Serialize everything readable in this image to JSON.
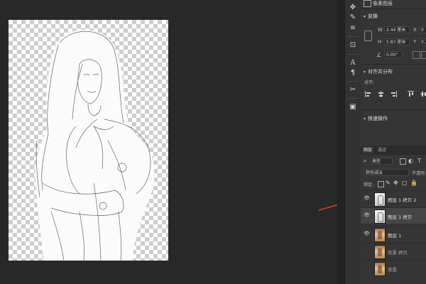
{
  "properties": {
    "layer_kind_label": "像素图层",
    "transform": {
      "title": "变换",
      "w_label": "W",
      "w_value": "2.44 厘米",
      "x_label": "X",
      "x_value": "0",
      "h_label": "H",
      "h_value": "5.83 厘米",
      "y_label": "Y",
      "y_value": "0.2",
      "angle_value": "0.00°"
    },
    "align": {
      "title": "对齐并分布",
      "subtitle": "对齐:"
    },
    "quick_actions": {
      "title": "快速操作"
    }
  },
  "layers_panel": {
    "tabs": [
      "图层",
      "通道"
    ],
    "filter_label": "类型",
    "blend_mode": "颜色减淡",
    "opacity_label": "不透明",
    "lock_label": "锁定:",
    "layers": [
      {
        "name": "图层 1 拷贝 2",
        "visible": true
      },
      {
        "name": "图层 1 拷贝",
        "visible": true
      },
      {
        "name": "图层 1",
        "visible": true
      },
      {
        "name": "背景 拷贝",
        "visible": false
      },
      {
        "name": "背景",
        "visible": false
      }
    ]
  },
  "colors": {
    "canvas_bg": "#282828",
    "panel_bg": "#353535",
    "selected_row": "#454545",
    "arrow": "#e03a2e"
  },
  "icons": [
    "move-icon",
    "brush-icon",
    "adjust-icon",
    "stamp-icon",
    "character-icon",
    "paragraph-icon",
    "tools-icon",
    "library-icon",
    "eye-icon",
    "link-icon",
    "align-icon"
  ]
}
